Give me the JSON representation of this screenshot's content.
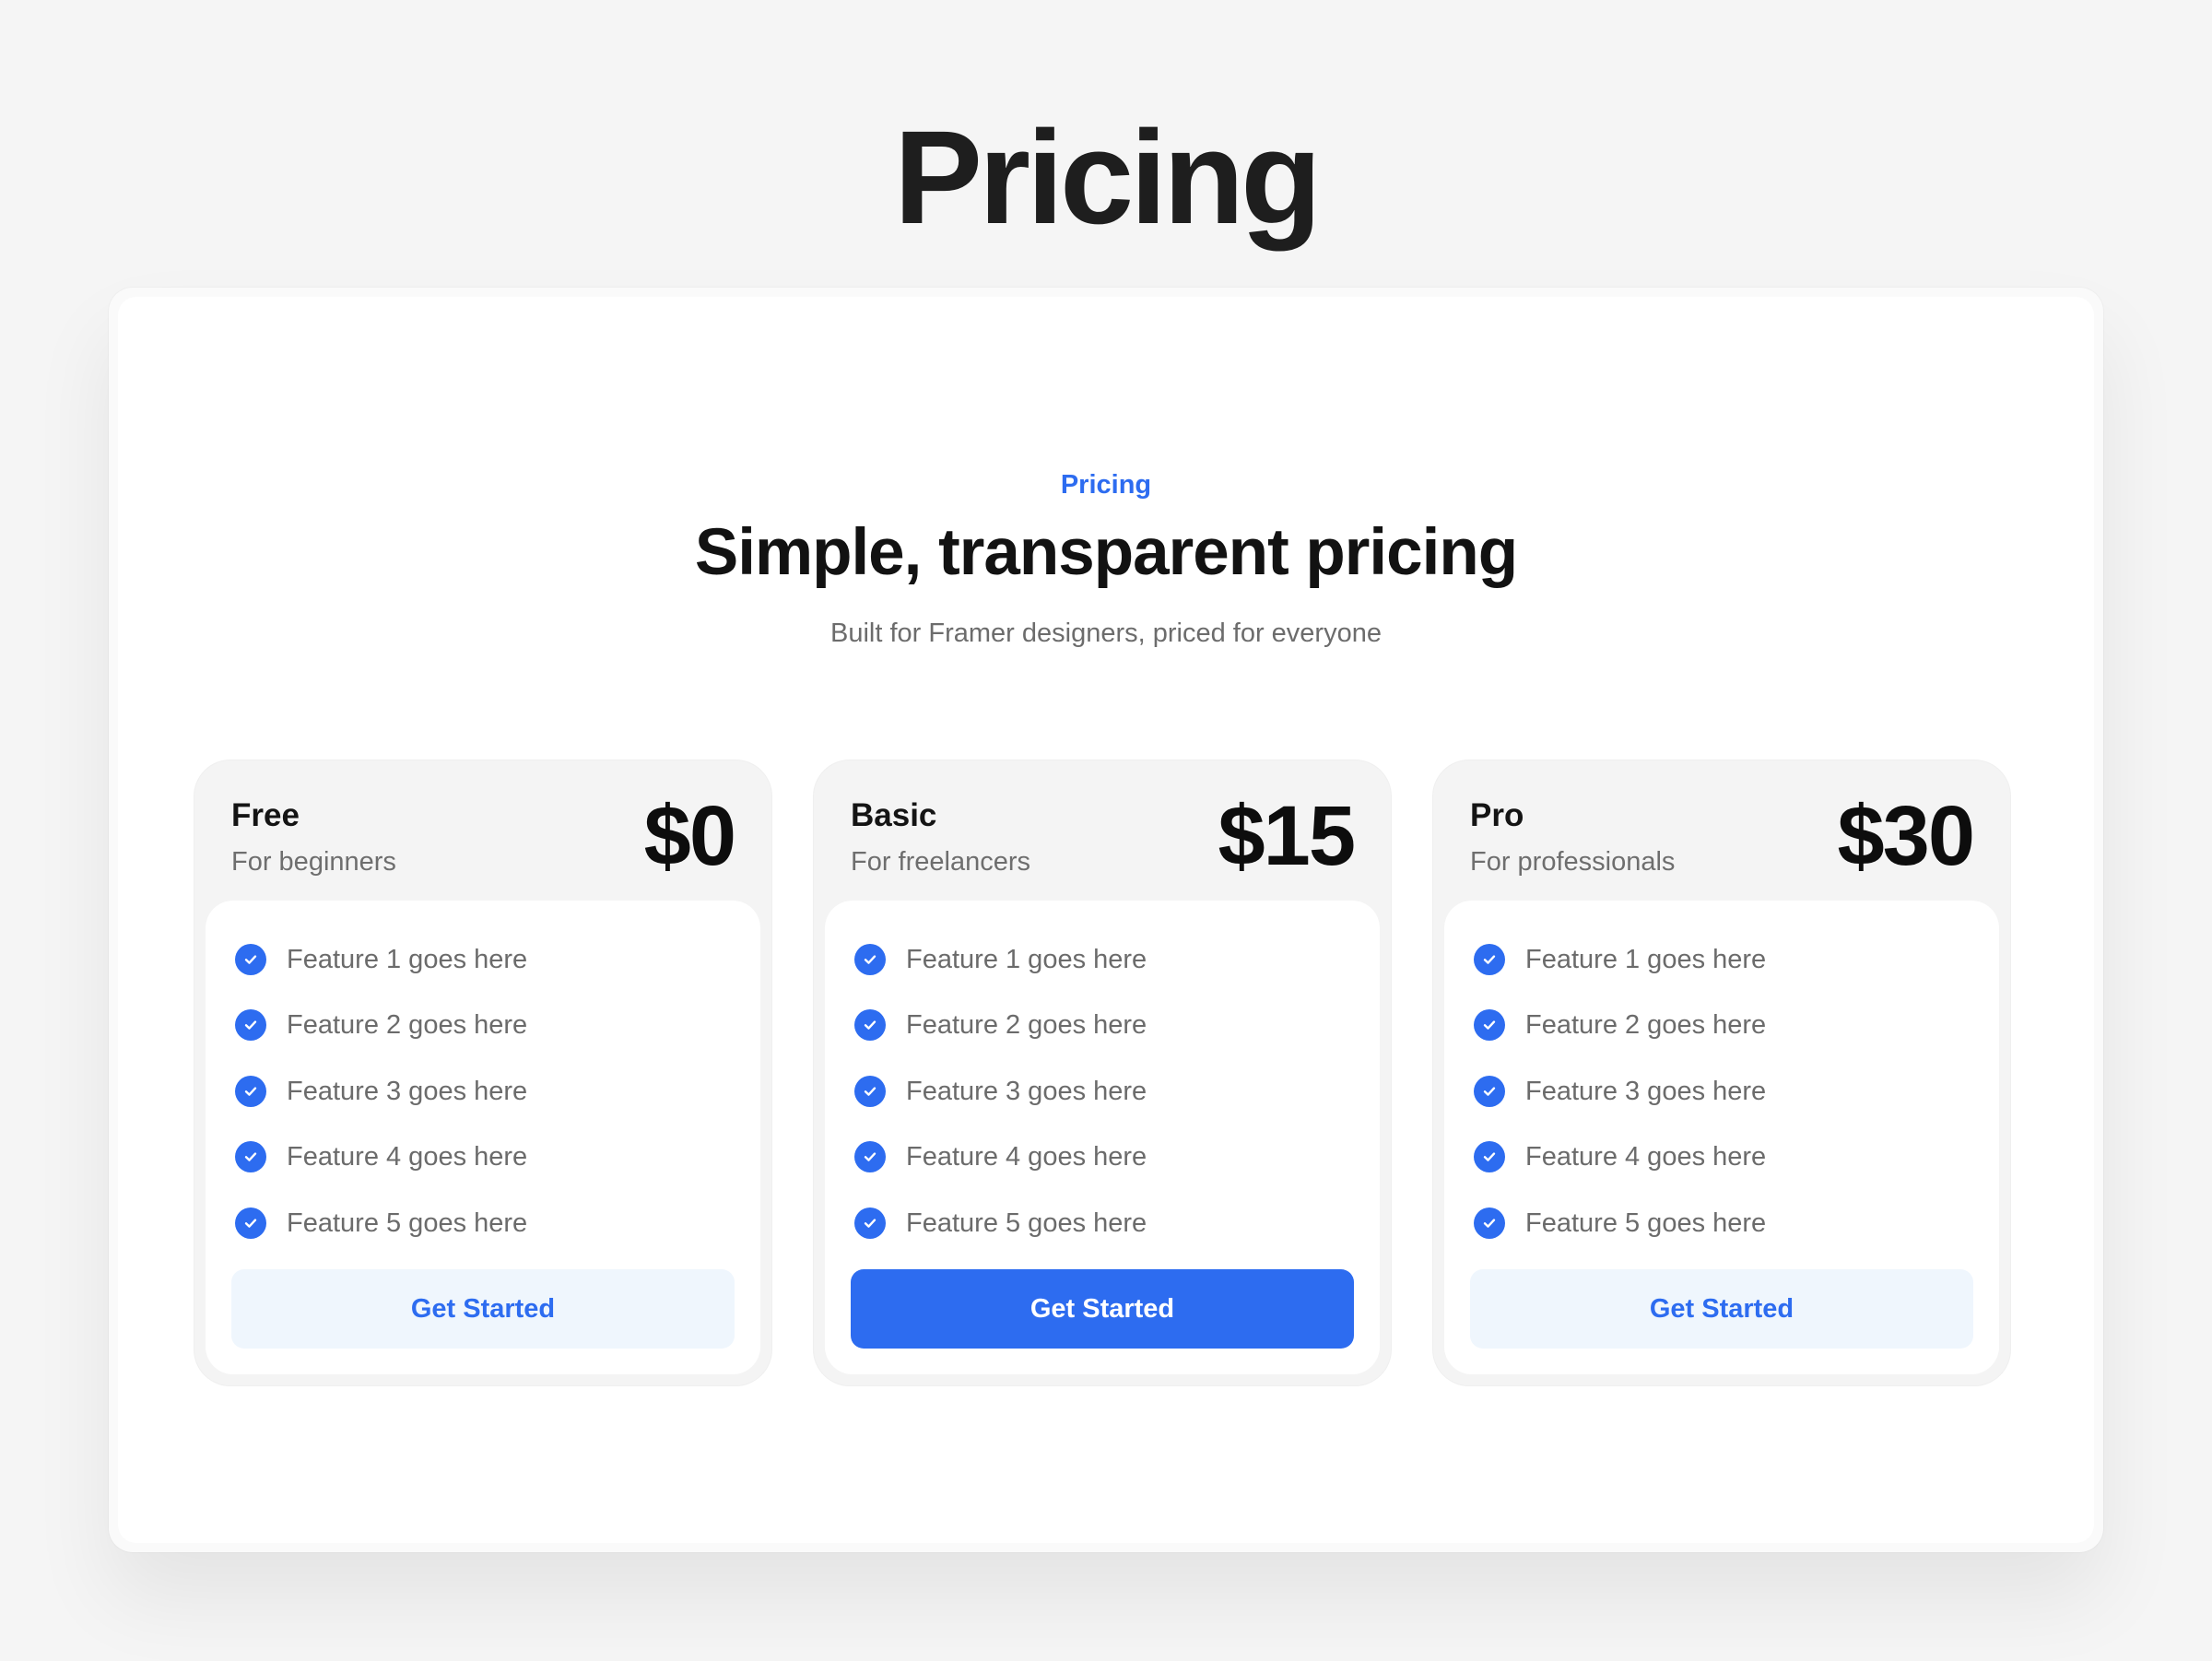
{
  "page": {
    "title": "Pricing"
  },
  "section": {
    "eyebrow": "Pricing",
    "headline": "Simple, transparent pricing",
    "subhead": "Built for Framer designers, priced for everyone"
  },
  "plans": [
    {
      "name": "Free",
      "tagline": "For beginners",
      "price": "$0",
      "features": [
        "Feature 1 goes here",
        "Feature 2 goes here",
        "Feature 3 goes here",
        "Feature 4 goes here",
        "Feature 5 goes here"
      ],
      "cta": "Get Started",
      "highlighted": false
    },
    {
      "name": "Basic",
      "tagline": "For freelancers",
      "price": "$15",
      "features": [
        "Feature 1 goes here",
        "Feature 2 goes here",
        "Feature 3 goes here",
        "Feature 4 goes here",
        "Feature 5 goes here"
      ],
      "cta": "Get Started",
      "highlighted": true
    },
    {
      "name": "Pro",
      "tagline": "For professionals",
      "price": "$30",
      "features": [
        "Feature 1 goes here",
        "Feature 2 goes here",
        "Feature 3 goes here",
        "Feature 4 goes here",
        "Feature 5 goes here"
      ],
      "cta": "Get Started",
      "highlighted": false
    }
  ],
  "colors": {
    "accent": "#2d6cf0",
    "page_background": "#f5f5f5",
    "secondary_button_background": "#eff6fd",
    "heading_text": "#1e1e1e",
    "muted_text": "#6b6b6b"
  },
  "icons": {
    "feature_check": "check-circle-icon"
  }
}
